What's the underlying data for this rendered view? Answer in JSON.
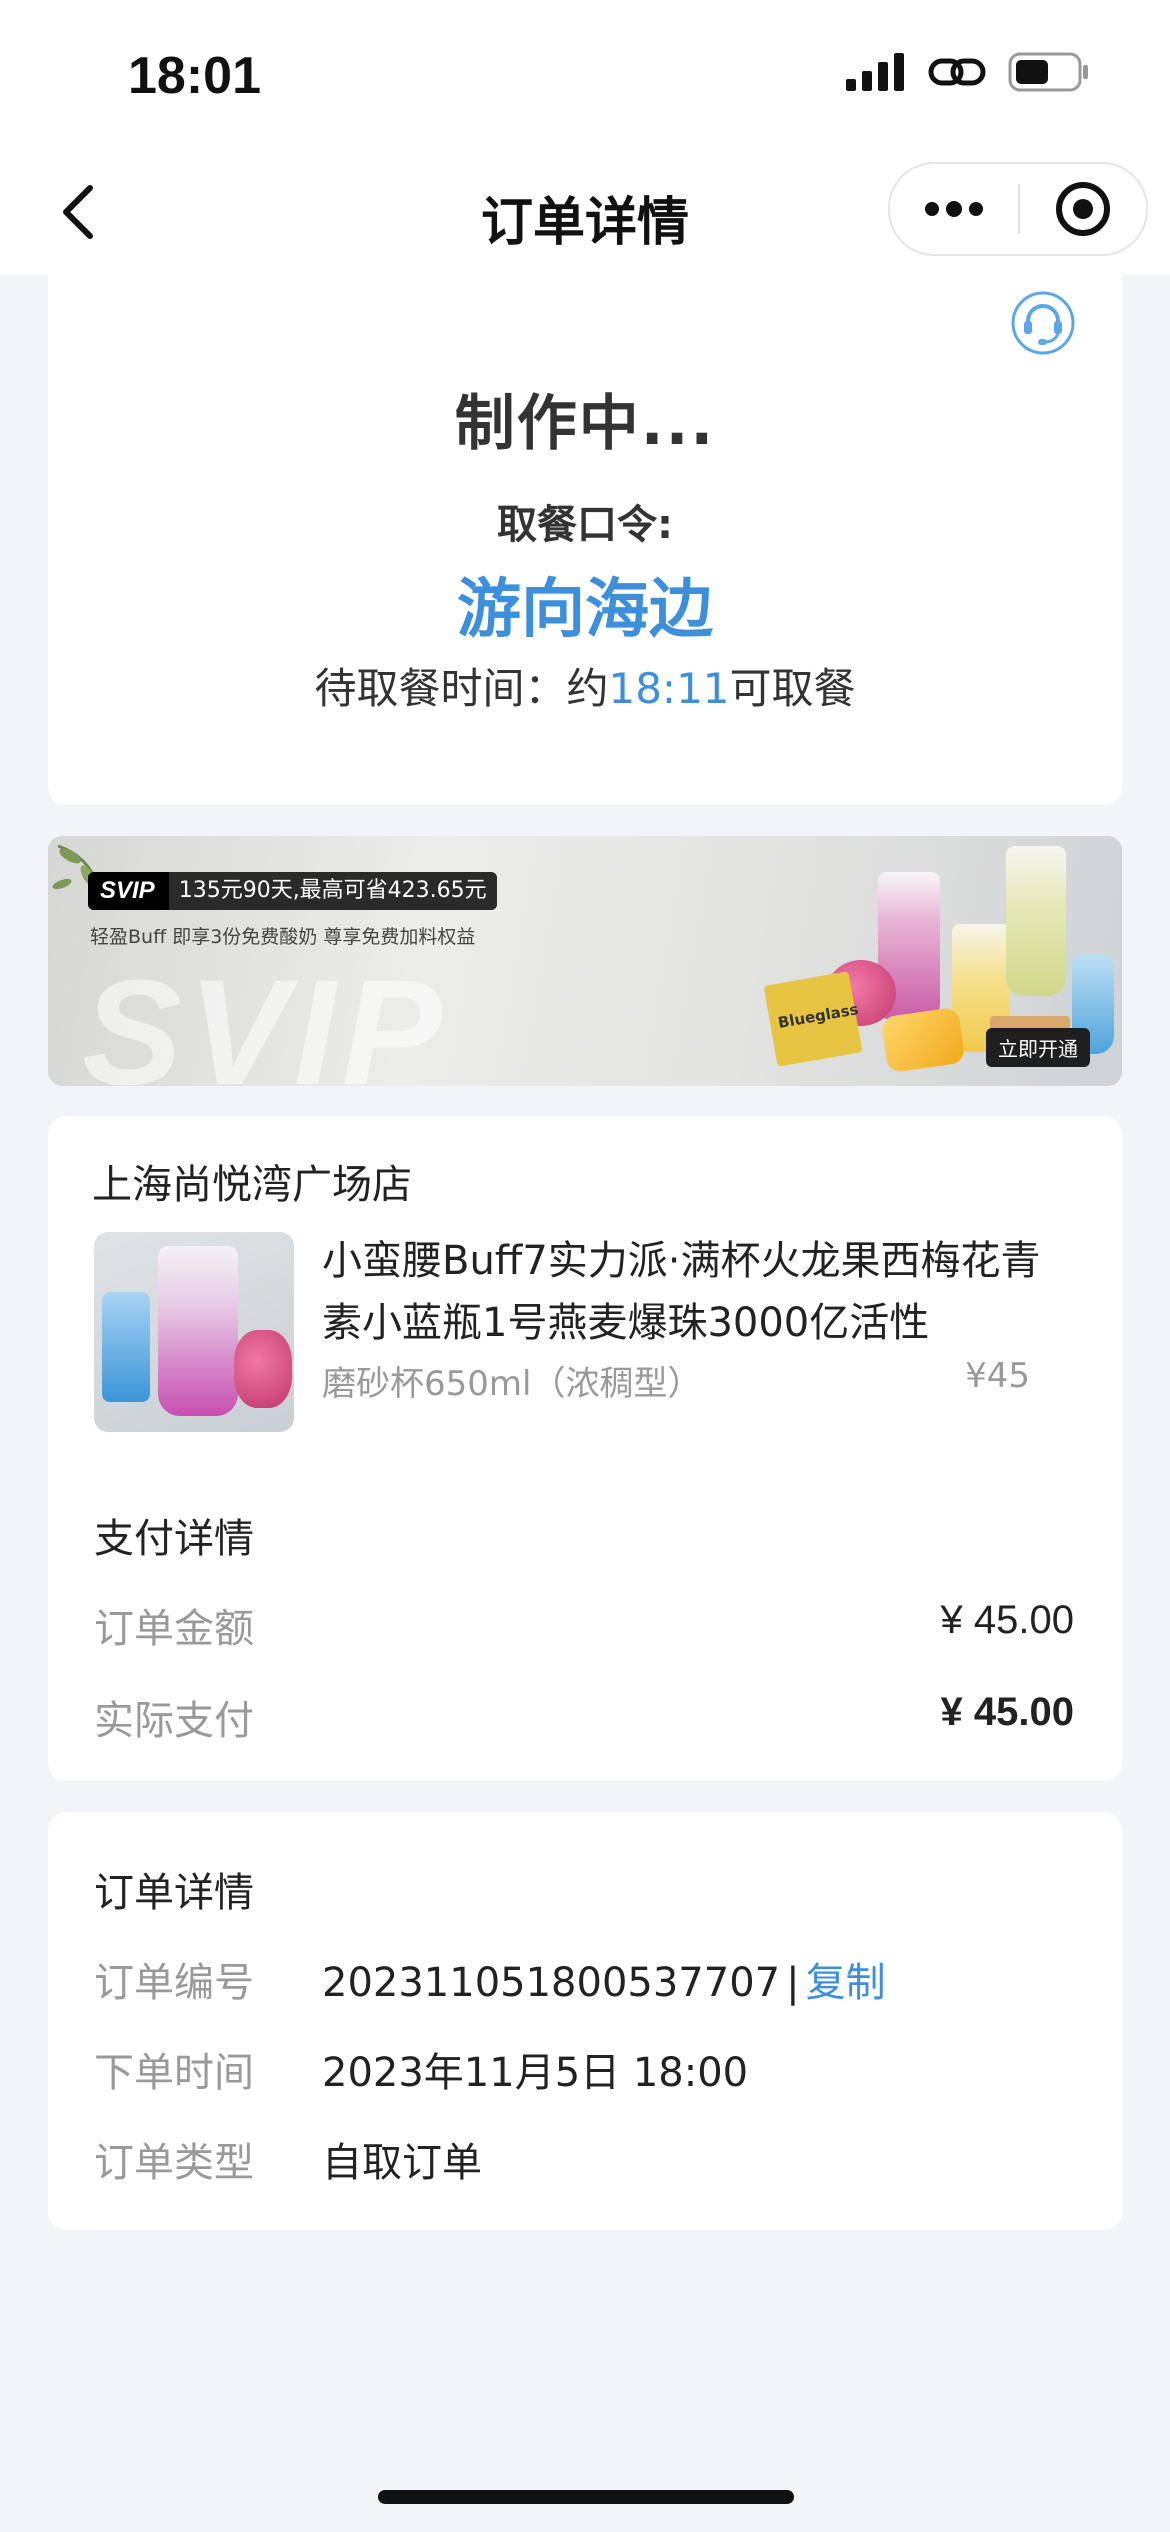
{
  "status_bar": {
    "time": "18:01"
  },
  "nav": {
    "title": "订单详情"
  },
  "order_status": {
    "state": "制作中...",
    "pickup_label": "取餐口令:",
    "pickup_code": "游向海边",
    "wait_prefix": "待取餐时间：约",
    "wait_time": "18:11",
    "wait_suffix": "可取餐"
  },
  "banner": {
    "svip_tag": "SVIP",
    "offer": "135元90天,最高可省423.65元",
    "subtitle": "轻盈Buff  即享3份免费酸奶  尊享免费加料权益",
    "watermark": "SVIP",
    "box_label": "Blueglass",
    "open_button": "立即开通"
  },
  "order": {
    "shop_name": "上海尚悦湾广场店",
    "product_name": "小蛮腰Buff7实力派·满杯火龙果西梅花青素小蓝瓶1号燕麦爆珠3000亿活性",
    "product_spec": "磨砂杯650ml（浓稠型）",
    "product_price": "¥45",
    "pay_title": "支付详情",
    "amount_label": "订单金额",
    "amount_value": "¥ 45.00",
    "paid_label": "实际支付",
    "paid_value": "¥ 45.00"
  },
  "details": {
    "title": "订单详情",
    "number_label": "订单编号",
    "number_value": "202311051800537707",
    "separator": "|",
    "copy_label": "复制",
    "time_label": "下单时间",
    "time_value": "2023年11月5日 18:00",
    "type_label": "订单类型",
    "type_value": "自取订单"
  },
  "colors": {
    "accent": "#3d8fdc",
    "background": "#f3f4f7",
    "muted": "#999999"
  }
}
